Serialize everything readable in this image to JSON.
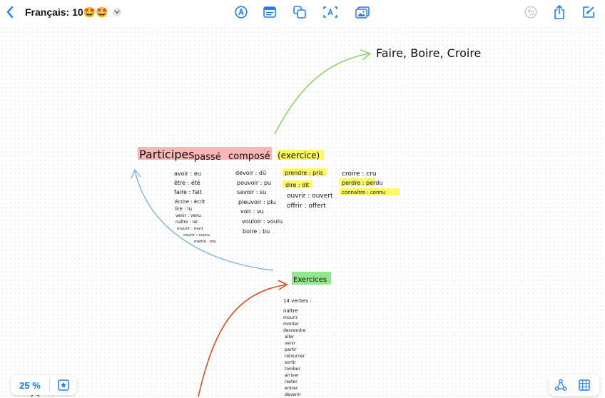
{
  "toolbar": {
    "title": "Français: 10🤩🤩",
    "icons": [
      "back-chevron-icon",
      "title-menu-chevron-icon",
      "pen-tool-icon",
      "text-box-icon",
      "shapes-icon",
      "text-insert-icon",
      "media-insert-icon",
      "undo-icon",
      "share-icon",
      "compose-icon"
    ]
  },
  "colors": {
    "accent": "#1f7cf4",
    "highlight_red": "#f7a9a8",
    "highlight_yellow": "#fbf84c",
    "highlight_green": "#7fe27a",
    "arrow_green": "#8dd36a",
    "arrow_blue": "#7fb2e0",
    "arrow_red": "#dd4a1c"
  },
  "board": {
    "heading": "Faire, Boire, Croire",
    "title": {
      "part1": "Participes",
      "part2": "passé",
      "part3": "composé",
      "part4": "(exercice)"
    },
    "col1": [
      "avoir : eu",
      "être : été",
      "faire : fait",
      "écrire : écrit",
      "lire : lu",
      "venir : venu",
      "naître : né",
      "mourir : mort",
      "courir : couru",
      "mettre : mis"
    ],
    "col2": [
      "devoir : dû",
      "pouvoir : pu",
      "savoir : su",
      "pleuvoir : plu",
      "voir : vu",
      "vouloir : voulu",
      "boire : bu"
    ],
    "col3": [
      "prendre : pris",
      "dire : dit",
      "ouvrir : ouvert",
      "offrir : offert"
    ],
    "col4": [
      "croire : cru",
      "perdre : perdu",
      "connaître : connu"
    ],
    "exercices": {
      "title": "Exercices",
      "subtitle": "14 verbes :",
      "verbs": [
        "naître",
        "mourir",
        "monter",
        "descendre",
        "aller",
        "venir",
        "partir",
        "retourner",
        "sortir",
        "tomber",
        "arriver",
        "rester",
        "entrer",
        "devenir"
      ]
    }
  },
  "footer": {
    "zoom": "25 %"
  }
}
